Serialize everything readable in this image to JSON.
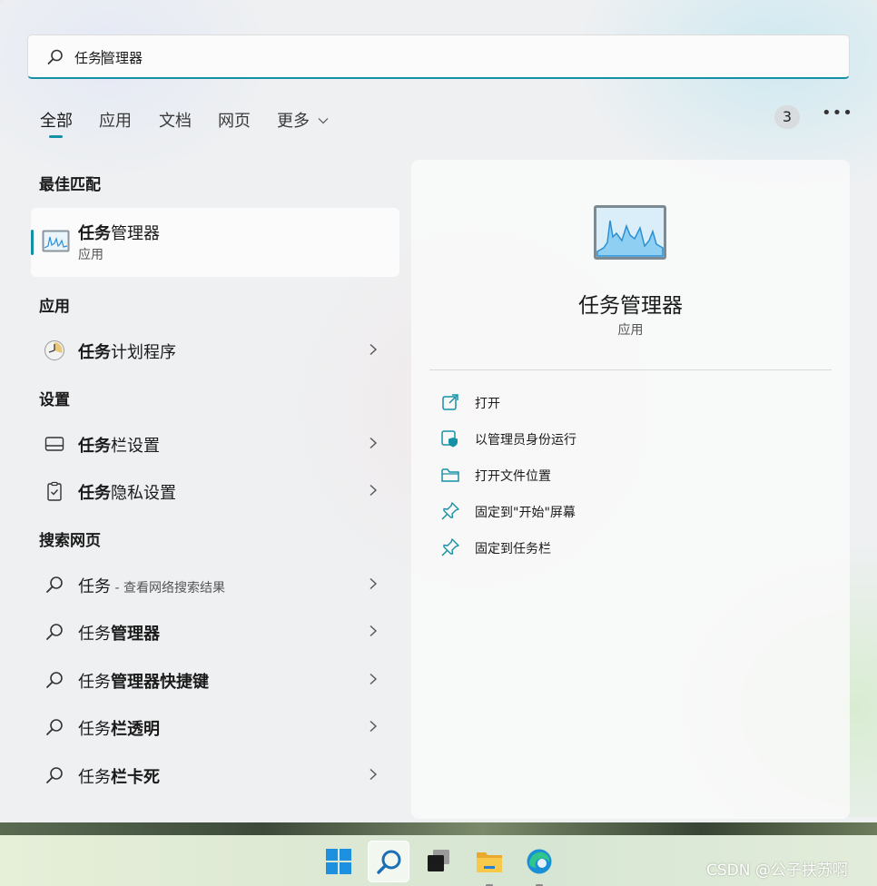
{
  "search": {
    "typed": "任务",
    "suggested": "管理器"
  },
  "tabs": [
    {
      "label": "全部"
    },
    {
      "label": "应用"
    },
    {
      "label": "文档"
    },
    {
      "label": "网页"
    },
    {
      "label": "更多"
    }
  ],
  "result_count_badge": "3",
  "sections": {
    "best_match": "最佳匹配",
    "apps": "应用",
    "settings": "设置",
    "web": "搜索网页"
  },
  "best_match": {
    "title_bold": "任务",
    "title_rest": "管理器",
    "subtitle": "应用"
  },
  "app_results": [
    {
      "bold": "任务",
      "rest": "计划程序"
    }
  ],
  "settings_results": [
    {
      "bold": "任务",
      "rest": "栏设置"
    },
    {
      "bold": "任务",
      "rest": "隐私设置"
    }
  ],
  "web_results": [
    {
      "plain": "任务",
      "bold": "",
      "hint": " - 查看网络搜索结果"
    },
    {
      "plain": "任务",
      "bold": "管理器",
      "hint": ""
    },
    {
      "plain": "任务",
      "bold": "管理器快捷键",
      "hint": ""
    },
    {
      "plain": "任务",
      "bold": "栏透明",
      "hint": ""
    },
    {
      "plain": "任务",
      "bold": "栏卡死",
      "hint": ""
    }
  ],
  "detail": {
    "title": "任务管理器",
    "subtitle": "应用",
    "actions": [
      {
        "label": "打开",
        "icon": "open-external-icon"
      },
      {
        "label": "以管理员身份运行",
        "icon": "admin-shield-icon"
      },
      {
        "label": "打开文件位置",
        "icon": "folder-icon"
      },
      {
        "label": "固定到\"开始\"屏幕",
        "icon": "pin-icon"
      },
      {
        "label": "固定到任务栏",
        "icon": "pin-icon"
      }
    ]
  },
  "taskbar": {
    "items": [
      "start-icon",
      "search-icon",
      "task-view-icon",
      "file-explorer-icon",
      "edge-icon"
    ]
  },
  "watermark": "CSDN @公子扶苏啊",
  "colors": {
    "accent": "#1591a5"
  }
}
